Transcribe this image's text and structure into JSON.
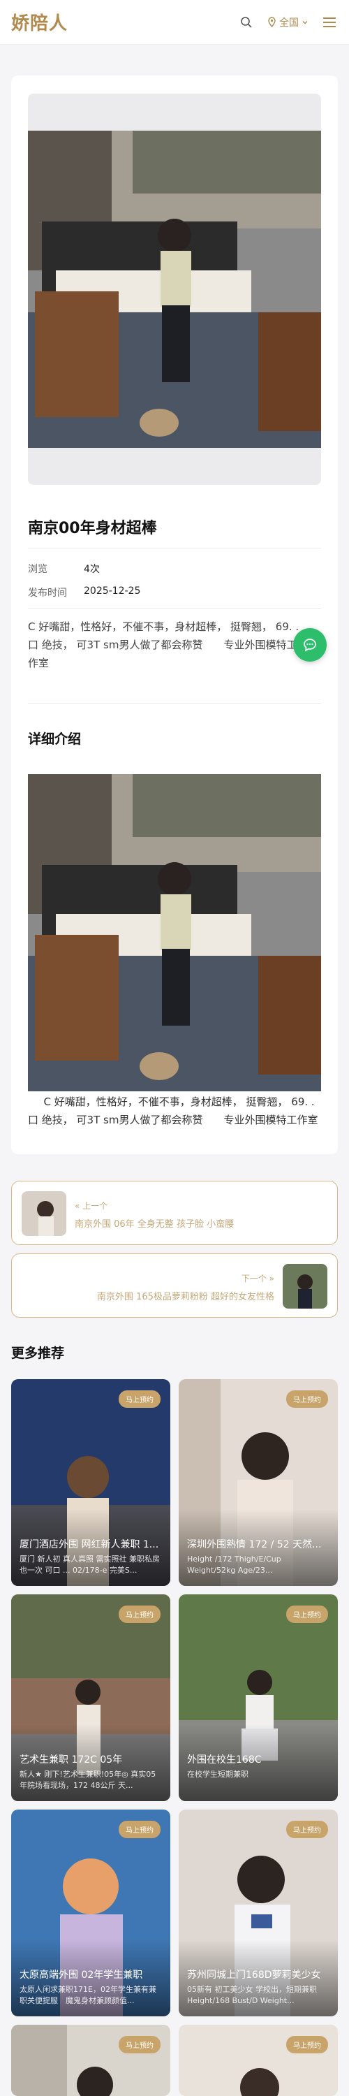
{
  "header": {
    "logo": "娇陪人",
    "region_label": "全国",
    "icons": {
      "search": "search-icon",
      "location": "pin-icon",
      "dropdown": "chevron-down-icon",
      "menu": "hamburger-icon"
    },
    "accent_color": "#b08a4e"
  },
  "post": {
    "title": "南京00年身材超棒",
    "views_label": "浏览",
    "views_value": "4次",
    "date_label": "发布时间",
    "date_value": "2025-12-25",
    "description": "C 好嘴甜，性格好，不催不事，身材超棒， 挺臀翘， 69. . 口 绝技， 可3T sm男人做了都会称赞　　专业外围模特工作室",
    "detail_heading": "详细介绍",
    "detail_text": "C 好嘴甜，性格好，不催不事，身材超棒， 挺臀翘， 69. . 口 绝技， 可3T sm男人做了都会称赞　　专业外围模特工作室"
  },
  "prev": {
    "label": "« 上一个",
    "title": "南京外围 06年 全身无整 孩子脸 小蛮腰"
  },
  "next": {
    "label": "下一个 »",
    "title": "南京外围 165极品萝莉粉粉 超好的女友性格"
  },
  "more": {
    "heading": "更多推荐",
    "badge": "马上预约",
    "items": [
      {
        "title": "厦门酒店外围 网红新人兼职 1...",
        "sub": "厦门 新人初 真人真照 需实照社 兼职私房 也一次 可口 ... 02/178-e 完美S..."
      },
      {
        "title": "深圳外围熟情 172 / 52 天然...",
        "sub": "Height /172 Thigh/E/Cup Weight/52kg Age/23..."
      },
      {
        "title": "艺术生兼职 172C 05年",
        "sub": "新人★ 刚下!艺术生兼职!05年◎ 真实05年院场看现场，172 48公斤 天..."
      },
      {
        "title": "外围在校生168C",
        "sub": "在校学生短期兼职"
      },
      {
        "title": "太原高端外围 02年学生兼职",
        "sub": "太原人闲求兼职171E，02年学生兼有兼职关便提服　魔鬼身材兼顾颜值..."
      },
      {
        "title": "苏州同城上门168D萝莉美少女",
        "sub": "05新有 初工美少女 学校出，短期兼职 Height/168 Bust/D Weight..."
      },
      {
        "title": "",
        "sub": ""
      },
      {
        "title": "",
        "sub": ""
      }
    ]
  },
  "chat_button": {
    "icon": "chat-bubble-icon",
    "color": "#2dbe6c"
  }
}
